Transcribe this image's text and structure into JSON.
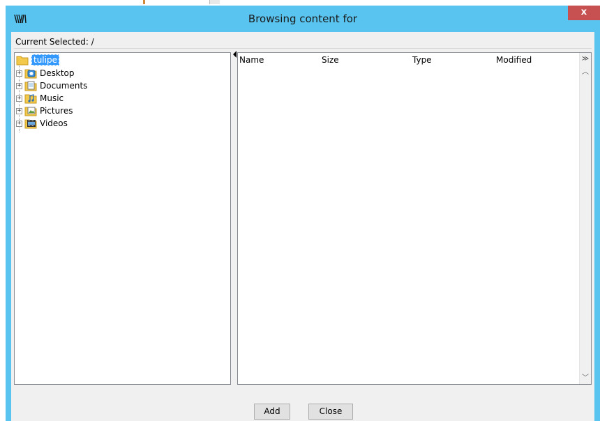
{
  "window": {
    "title": "Browsing content for",
    "close_label": "x"
  },
  "current_selection": {
    "label": "Current Selected: /"
  },
  "tree": {
    "root": {
      "label": "tulipe",
      "icon": "folder-icon"
    },
    "items": [
      {
        "label": "Desktop",
        "icon": "desktop-folder-icon"
      },
      {
        "label": "Documents",
        "icon": "documents-folder-icon"
      },
      {
        "label": "Music",
        "icon": "music-folder-icon"
      },
      {
        "label": "Pictures",
        "icon": "pictures-folder-icon"
      },
      {
        "label": "Videos",
        "icon": "videos-folder-icon"
      }
    ],
    "expander_symbol": "+"
  },
  "file_list": {
    "columns": [
      "Name",
      "Size",
      "Type",
      "Modified"
    ],
    "rows": []
  },
  "buttons": {
    "add": "Add",
    "close": "Close"
  },
  "colors": {
    "titlebar": "#59c4ef",
    "close": "#c75050",
    "selection": "#3399ff"
  }
}
